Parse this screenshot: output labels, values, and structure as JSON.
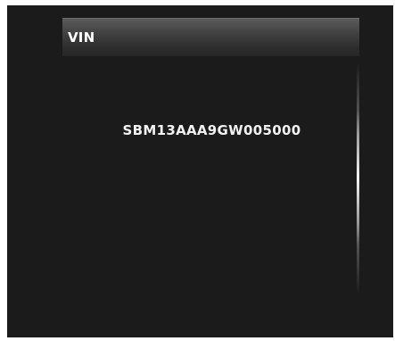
{
  "header": {
    "title": "VIN"
  },
  "content": {
    "vin_value": "SBM13AAA9GW005000"
  },
  "scrollbar": {
    "position_fraction": 0.3
  }
}
